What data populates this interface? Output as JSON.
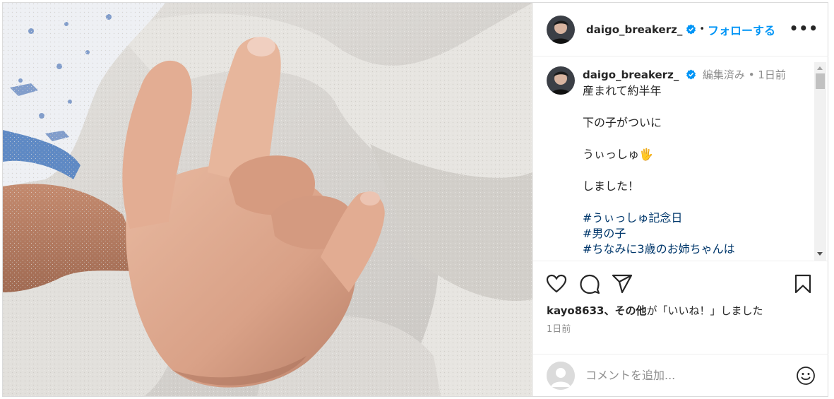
{
  "post": {
    "author": "daigo_breakerz_",
    "separator": "•",
    "follow_label": "フォローする",
    "more_label": "•••"
  },
  "caption": {
    "author": "daigo_breakerz_",
    "meta": "編集済み • 1日前",
    "lines": [
      "産まれて約半年",
      "下の子がついに",
      "うぃっしゅ🖐",
      "しました！"
    ],
    "hashtags": [
      "#うぃっしゅ記念日",
      "#男の子",
      "#ちなみに3歳のお姉ちゃんは"
    ]
  },
  "likes": {
    "user": "kayo8633、",
    "others": "その他",
    "suffix": "が「いいね！」しました"
  },
  "timestamp": "1日前",
  "comment": {
    "placeholder": "コメントを追加..."
  },
  "icons": {
    "like": "heart-icon",
    "comment": "comment-icon",
    "share": "share-icon",
    "save": "bookmark-icon",
    "emoji": "emoji-icon",
    "verified": "verified-badge-icon"
  },
  "colors": {
    "follow": "#0095f6",
    "hashtag": "#00376b",
    "verified": "#0095f6",
    "muted": "#8e8e8e"
  }
}
